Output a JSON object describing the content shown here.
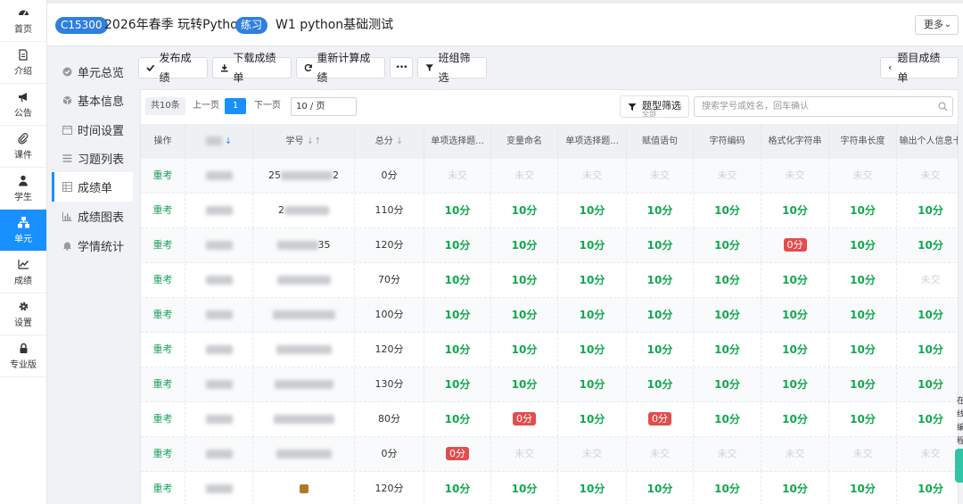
{
  "rail": [
    {
      "label": "首页",
      "icon": "dashboard-icon"
    },
    {
      "label": "介绍",
      "icon": "document-icon"
    },
    {
      "label": "公告",
      "icon": "megaphone-icon"
    },
    {
      "label": "课件",
      "icon": "paperclip-icon"
    },
    {
      "label": "学生",
      "icon": "user-icon"
    },
    {
      "label": "单元",
      "icon": "sitemap-icon",
      "active": true
    },
    {
      "label": "成绩",
      "icon": "line-chart-icon"
    },
    {
      "label": "设置",
      "icon": "gear-icon"
    },
    {
      "label": "专业版",
      "icon": "lock-icon"
    }
  ],
  "header": {
    "course_code": "C15300",
    "course_name": "2026年春季 玩转Python",
    "type_tag": "练习",
    "exam_name": "W1 python基础测试",
    "more_label": "更多"
  },
  "submenu": [
    {
      "label": "单元总览",
      "icon": "check-circle-icon"
    },
    {
      "label": "基本信息",
      "icon": "cube-icon"
    },
    {
      "label": "时间设置",
      "icon": "calendar-icon"
    },
    {
      "label": "习题列表",
      "icon": "list-icon"
    },
    {
      "label": "成绩单",
      "icon": "table-icon",
      "active": true
    },
    {
      "label": "成绩图表",
      "icon": "bar-chart-icon"
    },
    {
      "label": "学情统计",
      "icon": "bell-icon"
    }
  ],
  "toolbar": {
    "publish_label": "发布成绩",
    "download_label": "下载成绩单",
    "recalc_label": "重新计算成绩",
    "more_dots": "•••",
    "group_filter_label": "班组筛选",
    "question_scores_label": "题目成绩单"
  },
  "pager": {
    "total_label": "共10条",
    "prev_label": "上一页",
    "current_page": "1",
    "next_label": "下一页",
    "page_size_label": "10 / 页"
  },
  "filter": {
    "label": "题型筛选",
    "sub_label": "全部"
  },
  "search": {
    "placeholder": "搜索学号或姓名，回车确认"
  },
  "table": {
    "headers": [
      "操作",
      "",
      "学号",
      "总分",
      "单项选择题...",
      "变量命名",
      "单项选择题...",
      "赋值语句",
      "字符编码",
      "格式化字符串",
      "字符串长度",
      "输出个人信息卡"
    ],
    "rows": [
      {
        "action": "重考",
        "id_visible": "25",
        "id_tail": "2",
        "total": "0分",
        "scores": [
          "未交",
          "未交",
          "未交",
          "未交",
          "未交",
          "未交",
          "未交",
          "未交"
        ]
      },
      {
        "action": "重考",
        "id_visible": "2",
        "id_tail": "",
        "total": "110分",
        "scores": [
          "10分",
          "10分",
          "10分",
          "10分",
          "10分",
          "10分",
          "10分",
          "10分"
        ]
      },
      {
        "action": "重考",
        "id_visible": "",
        "id_tail": "35",
        "total": "120分",
        "scores": [
          "10分",
          "10分",
          "10分",
          "10分",
          "10分",
          "0分",
          "10分",
          "10分"
        ]
      },
      {
        "action": "重考",
        "id_visible": "",
        "id_tail": "",
        "total": "70分",
        "scores": [
          "10分",
          "10分",
          "10分",
          "10分",
          "10分",
          "10分",
          "10分",
          "未交"
        ]
      },
      {
        "action": "重考",
        "id_visible": "",
        "id_tail": "",
        "total": "100分",
        "scores": [
          "10分",
          "10分",
          "10分",
          "10分",
          "10分",
          "10分",
          "10分",
          "10分"
        ]
      },
      {
        "action": "重考",
        "id_visible": "",
        "id_tail": "",
        "total": "120分",
        "scores": [
          "10分",
          "10分",
          "10分",
          "10分",
          "10分",
          "10分",
          "10分",
          "10分"
        ]
      },
      {
        "action": "重考",
        "id_visible": "",
        "id_tail": "",
        "total": "130分",
        "scores": [
          "10分",
          "10分",
          "10分",
          "10分",
          "10分",
          "10分",
          "10分",
          "10分"
        ]
      },
      {
        "action": "重考",
        "id_visible": "",
        "id_tail": "",
        "total": "80分",
        "scores": [
          "10分",
          "0分",
          "10分",
          "0分",
          "10分",
          "10分",
          "10分",
          "10分"
        ]
      },
      {
        "action": "重考",
        "id_visible": "",
        "id_tail": "",
        "total": "0分",
        "scores": [
          "0分",
          "未交",
          "未交",
          "未交",
          "未交",
          "未交",
          "未交",
          "未交"
        ]
      },
      {
        "action": "重考",
        "id_visible": "",
        "id_tail": "",
        "total": "120分",
        "scores": [
          "10分",
          "10分",
          "10分",
          "10分",
          "10分",
          "10分",
          "10分",
          "10分"
        ]
      }
    ]
  },
  "edge": {
    "chars": [
      "在",
      "线",
      "编",
      "程"
    ],
    "accent": "#2ec4a5"
  },
  "colors": {
    "primary": "#1890ff",
    "score_ok": "#11a84f",
    "score_zero": "#e34d4d",
    "retake": "#17a35c"
  }
}
